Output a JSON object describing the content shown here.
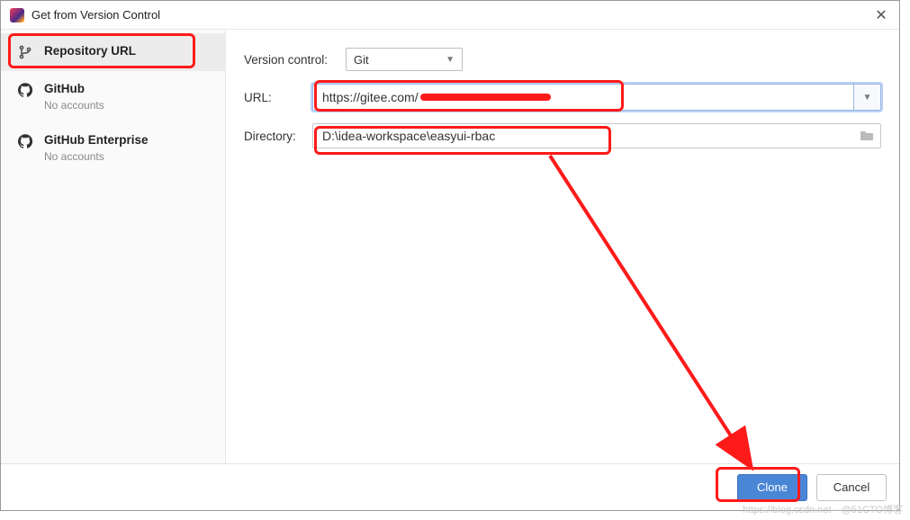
{
  "window": {
    "title": "Get from Version Control"
  },
  "sidebar": {
    "items": [
      {
        "label": "Repository URL",
        "sub": ""
      },
      {
        "label": "GitHub",
        "sub": "No accounts"
      },
      {
        "label": "GitHub Enterprise",
        "sub": "No accounts"
      }
    ]
  },
  "form": {
    "vcs_label": "Version control:",
    "vcs_value": "Git",
    "url_label": "URL:",
    "url_value_prefix": "https://gitee.com/",
    "directory_label": "Directory:",
    "directory_value": "D:\\idea-workspace\\easyui-rbac"
  },
  "buttons": {
    "clone": "Clone",
    "cancel": "Cancel"
  },
  "watermark": "https://blog.csdn.net—@51CTO博客"
}
